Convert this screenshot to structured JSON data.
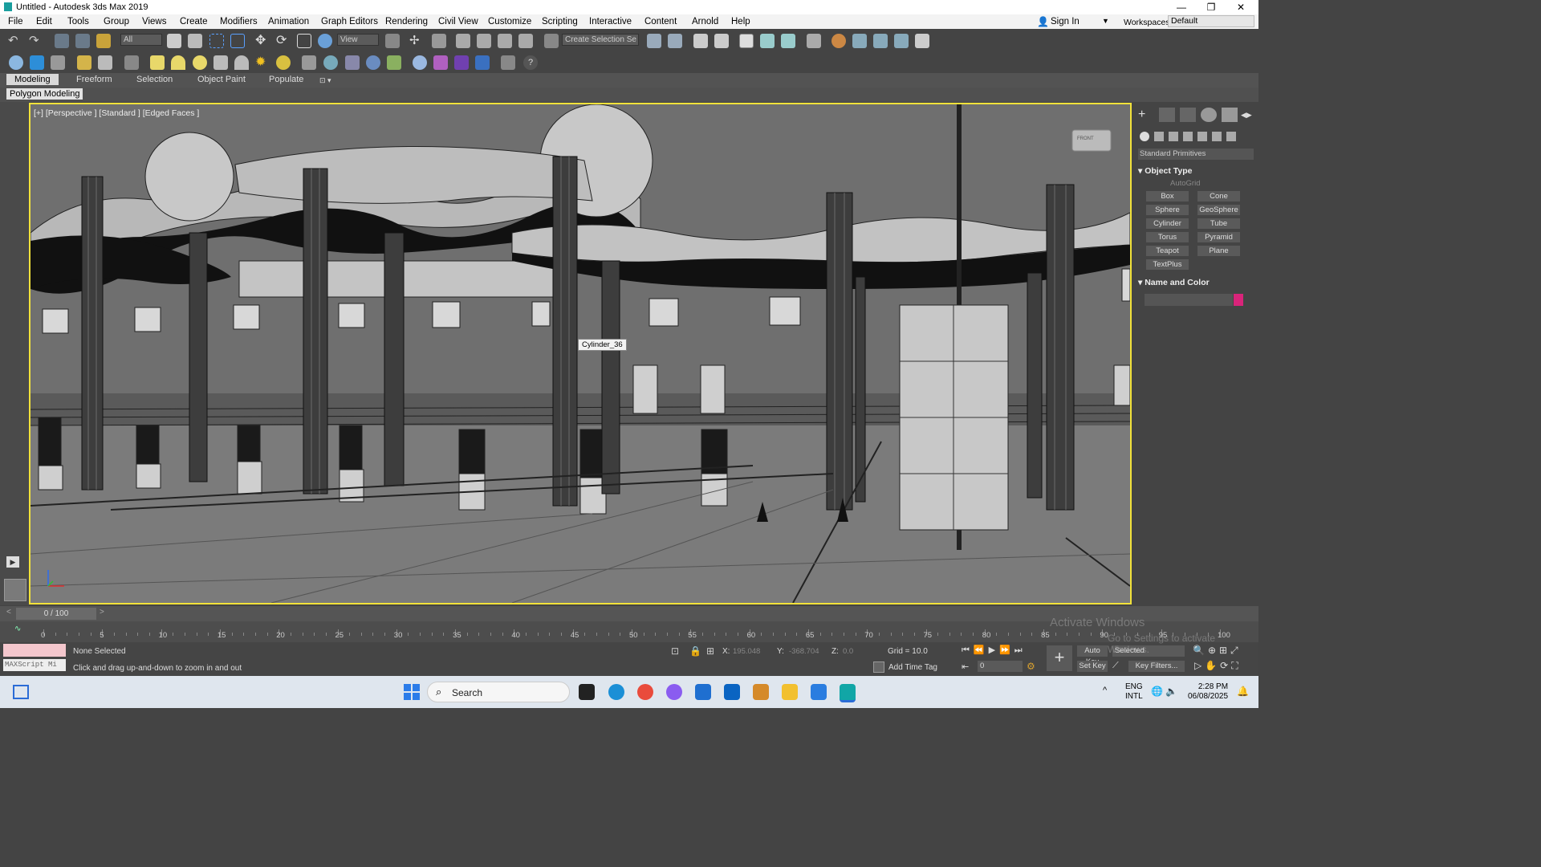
{
  "window": {
    "title": "Untitled - Autodesk 3ds Max 2019",
    "controls": [
      "—",
      "❐",
      "✕"
    ]
  },
  "menu": [
    "File",
    "Edit",
    "Tools",
    "Group",
    "Views",
    "Create",
    "Modifiers",
    "Animation",
    "Graph Editors",
    "Rendering",
    "Civil View",
    "Customize",
    "Scripting",
    "Interactive",
    "Content",
    "Arnold",
    "Help"
  ],
  "account": {
    "sign_in": "Sign In",
    "workspaces_label": "Workspaces:",
    "workspace": "Default"
  },
  "toolbar": {
    "filter": "All",
    "ref_coord": "View",
    "named_selection": "Create Selection Se"
  },
  "ribbon": {
    "tabs": [
      "Modeling",
      "Freeform",
      "Selection",
      "Object Paint",
      "Populate"
    ],
    "active": "Modeling",
    "sub_tab": "Polygon Modeling"
  },
  "viewport": {
    "label": "[+] [Perspective ] [Standard ] [Edged Faces ]",
    "tooltip": "Cylinder_36",
    "viewcube_label": "FRONT"
  },
  "command_panel": {
    "category": "Standard Primitives",
    "object_type_title": "Object Type",
    "autogrid": "AutoGrid",
    "primitives": [
      "Box",
      "Cone",
      "Sphere",
      "GeoSphere",
      "Cylinder",
      "Tube",
      "Torus",
      "Pyramid",
      "Teapot",
      "Plane",
      "TextPlus"
    ],
    "name_color_title": "Name and Color",
    "color": "#d9247a"
  },
  "timeline": {
    "frame_display": "0 / 100",
    "ticks": [
      "0",
      "5",
      "10",
      "15",
      "20",
      "25",
      "30",
      "35",
      "40",
      "45",
      "50",
      "55",
      "60",
      "65",
      "70",
      "75",
      "80",
      "85",
      "90",
      "95",
      "100"
    ]
  },
  "status": {
    "selection": "None Selected",
    "prompt": "Click and drag up-and-down to zoom in and out",
    "maxscript": "MAXScript Mi",
    "x_label": "X:",
    "x_value": "195.048",
    "y_label": "Y:",
    "y_value": "-368.704",
    "z_label": "Z:",
    "z_value": "0.0",
    "grid": "Grid = 10.0",
    "add_time_tag": "Add Time Tag",
    "auto_key": "Auto Key",
    "set_key": "Set Key",
    "key_mode": "Selected",
    "key_filters": "Key Filters...",
    "current_frame": "0"
  },
  "watermark": {
    "line1": "Activate Windows",
    "line2": "Go to Settings to activate Windows."
  },
  "taskbar": {
    "search": "Search",
    "lang1": "ENG",
    "lang2": "INTL",
    "time": "2:28 PM",
    "date": "06/08/2025"
  }
}
